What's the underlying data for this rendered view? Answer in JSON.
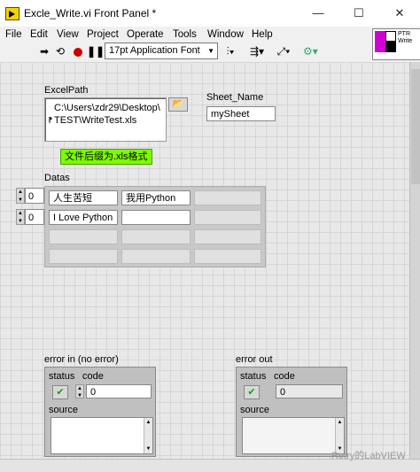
{
  "window": {
    "title": "Excle_Write.vi Front Panel *",
    "controls": {
      "minimize": "—",
      "maximize": "☐",
      "close": "✕"
    }
  },
  "menu": [
    "File",
    "Edit",
    "View",
    "Project",
    "Operate",
    "Tools",
    "Window",
    "Help"
  ],
  "toolbar": {
    "font": "17pt Application Font",
    "icons": [
      "run-arrow-icon",
      "run-continuous-icon",
      "abort-icon",
      "pause-icon",
      "align-icon",
      "distribute-icon",
      "resize-icon",
      "reorder-icon"
    ]
  },
  "connector_pane": {
    "label": "PTR\nWrite"
  },
  "panel": {
    "excel_path": {
      "label": "ExcelPath",
      "value_line1": "C:\\Users\\zdr29\\Desktop\\",
      "value_line2": "TEST\\WriteTest.xls"
    },
    "sheet_name": {
      "label": "Sheet_Name",
      "value": "mySheet"
    },
    "note": "文件后缀为.xls格式",
    "datas": {
      "label": "Datas",
      "row_index": "0",
      "col_index": "0",
      "cells": [
        [
          "人生苦短",
          "我用Python",
          ""
        ],
        [
          "I Love Python",
          "",
          ""
        ],
        [
          "",
          "",
          ""
        ],
        [
          "",
          "",
          ""
        ]
      ]
    },
    "error_in": {
      "label": "error in (no error)",
      "status_label": "status",
      "code_label": "code",
      "code_value": "0",
      "source_label": "source"
    },
    "error_out": {
      "label": "error out",
      "status_label": "status",
      "code_label": "code",
      "code_value": "0",
      "source_label": "source"
    }
  },
  "watermark": "Retry的LabVIEW"
}
